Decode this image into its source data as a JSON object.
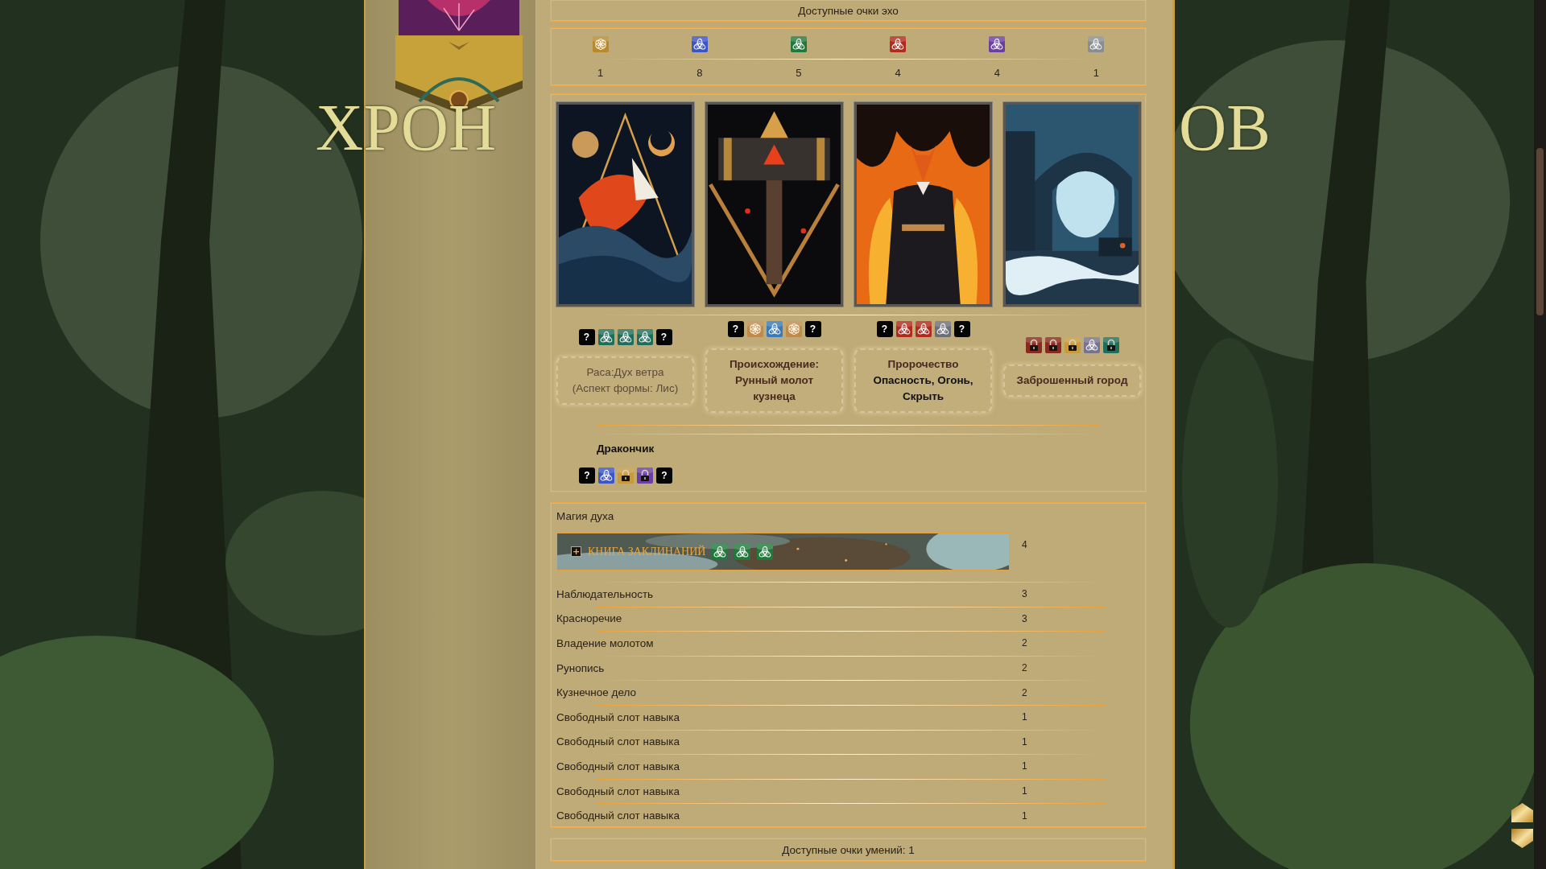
{
  "site_title": {
    "left": "ХРОН",
    "right": "ОВ"
  },
  "echo": {
    "heading": "Доступные очки эхо",
    "points": [
      {
        "kind": "flower",
        "color": "#b8892e",
        "value": "1"
      },
      {
        "kind": "rune",
        "color": "#3a55c8",
        "value": "8"
      },
      {
        "kind": "rune",
        "color": "#1f7a3a",
        "value": "5"
      },
      {
        "kind": "rune",
        "color": "#b02a1e",
        "value": "4"
      },
      {
        "kind": "rune",
        "color": "#6a3fa0",
        "value": "4"
      },
      {
        "kind": "rune",
        "color": "#8a8d90",
        "value": "1"
      }
    ]
  },
  "cards": [
    {
      "slots": [
        {
          "kind": "question",
          "label": "?"
        },
        {
          "kind": "rune",
          "color": "#1f6e5c"
        },
        {
          "kind": "rune",
          "color": "#1f6e5c"
        },
        {
          "kind": "rune",
          "color": "#1f6e5c"
        },
        {
          "kind": "question",
          "label": "?"
        }
      ],
      "caption": [
        {
          "kind": "muted",
          "text": "Раса:Дух ветра (Аспект формы: Лис)"
        }
      ]
    },
    {
      "slots": [
        {
          "kind": "question",
          "label": "?"
        },
        {
          "kind": "flower",
          "color": "#c08a4a"
        },
        {
          "kind": "rune",
          "color": "#3a7ab8"
        },
        {
          "kind": "flower",
          "color": "#c08a4a"
        },
        {
          "kind": "question",
          "label": "?"
        }
      ],
      "caption": [
        {
          "kind": "heading",
          "text": "Происхождение: Рунный молот кузнеца"
        }
      ]
    },
    {
      "slots": [
        {
          "kind": "question",
          "label": "?"
        },
        {
          "kind": "rune",
          "color": "#b02a1e"
        },
        {
          "kind": "rune",
          "color": "#b02a1e"
        },
        {
          "kind": "rune",
          "color": "#6e6e78"
        },
        {
          "kind": "question",
          "label": "?"
        }
      ],
      "caption": [
        {
          "kind": "heading",
          "text": "Пророчество"
        },
        {
          "kind": "emphasis",
          "text": "Опасность, Огонь, Скрыть"
        }
      ]
    },
    {
      "slots": [
        {
          "kind": "lock",
          "color": "#8a2a1e"
        },
        {
          "kind": "lock",
          "color": "#8a2a1e"
        },
        {
          "kind": "lock",
          "color": "#c89a3a"
        },
        {
          "kind": "rune",
          "color": "#77738c"
        },
        {
          "kind": "lock",
          "color": "#1f6e5c"
        }
      ],
      "caption": [
        {
          "kind": "heading",
          "text": "Заброшенный город"
        }
      ]
    }
  ],
  "companion": {
    "name": "Дракончик",
    "slots": [
      {
        "kind": "question",
        "label": "?"
      },
      {
        "kind": "rune",
        "color": "#3a55c8"
      },
      {
        "kind": "lock",
        "color": "#c89a3a"
      },
      {
        "kind": "lock",
        "color": "#6a3fa0"
      },
      {
        "kind": "question",
        "label": "?"
      }
    ]
  },
  "magic": {
    "heading": "Магия духа",
    "spellbook": {
      "expanded": false,
      "toggle": "+",
      "title": "КНИГА ЗАКЛИНАНИЙ",
      "value": "4",
      "slots": [
        {
          "kind": "rune",
          "color": "#1f7a3a"
        },
        {
          "kind": "rune",
          "color": "#1f7a3a"
        },
        {
          "kind": "rune",
          "color": "#1f7a3a"
        }
      ]
    },
    "skills": [
      {
        "name": "Наблюдательность",
        "value": "3"
      },
      {
        "name": "Красноречие",
        "value": "3"
      },
      {
        "name": "Владение молотом",
        "value": "2"
      },
      {
        "name": "Рунопись",
        "value": "2"
      },
      {
        "name": "Кузнечное дело",
        "value": "2"
      },
      {
        "name": "Свободный слот навыка",
        "value": "1"
      },
      {
        "name": "Свободный слот навыка",
        "value": "1"
      },
      {
        "name": "Свободный слот навыка",
        "value": "1"
      },
      {
        "name": "Свободный слот навыка",
        "value": "1"
      },
      {
        "name": "Свободный слот навыка",
        "value": "1"
      }
    ]
  },
  "skill_points": "Доступные очки умений: 1"
}
